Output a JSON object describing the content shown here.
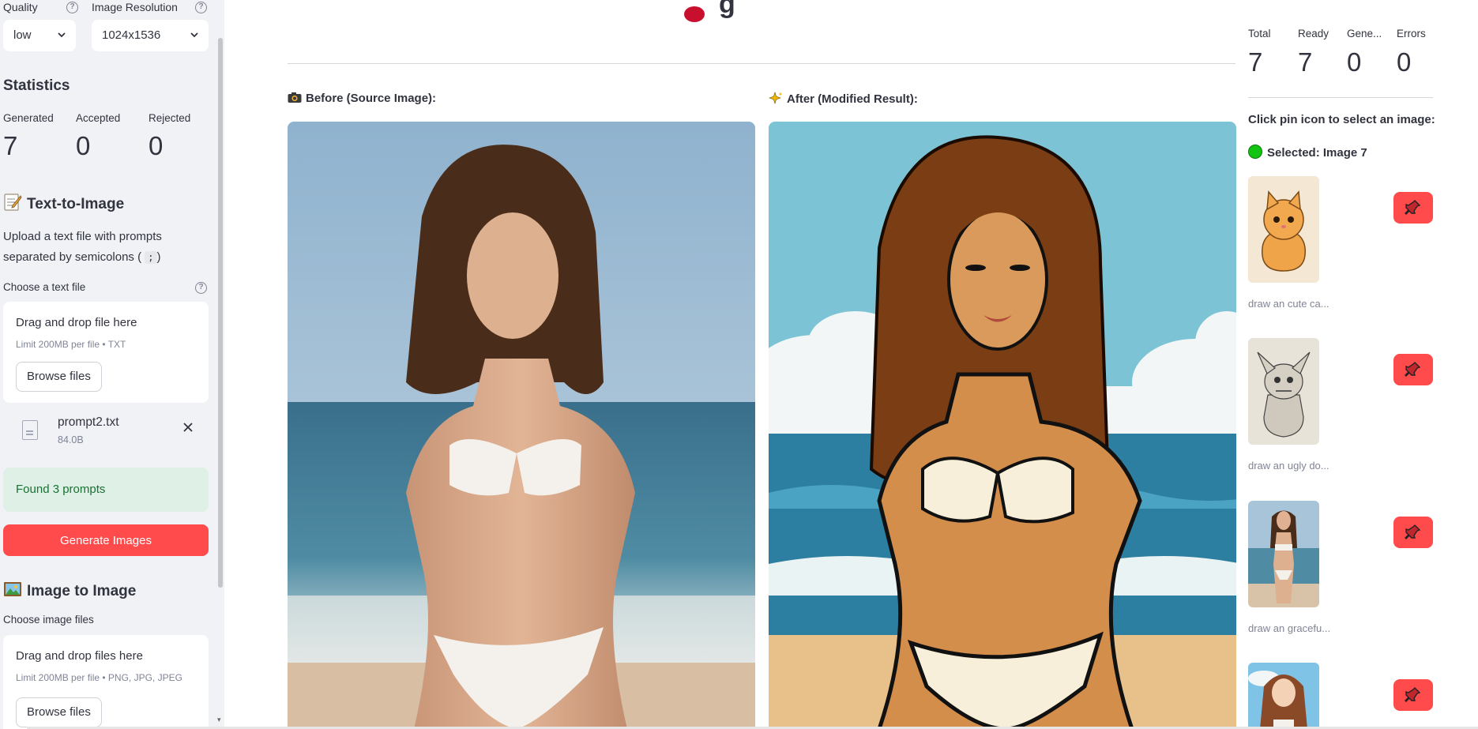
{
  "sidebar": {
    "quality_label": "Quality",
    "quality_value": "low",
    "resolution_label": "Image Resolution",
    "resolution_value": "1024x1536",
    "help_icon": "?",
    "statistics_title": "Statistics",
    "metrics": [
      {
        "label": "Generated",
        "value": "7"
      },
      {
        "label": "Accepted",
        "value": "0"
      },
      {
        "label": "Rejected",
        "value": "0"
      }
    ],
    "text_to_image": {
      "title": "Text-to-Image",
      "description_pre": "Upload a text file with prompts separated by semicolons (",
      "description_code": ";",
      "description_post": ")",
      "file_label": "Choose a text file",
      "drop_title": "Drag and drop file here",
      "drop_limit": "Limit 200MB per file • TXT",
      "browse_label": "Browse files",
      "file_name": "prompt2.txt",
      "file_size": "84.0B",
      "success_message": "Found 3 prompts",
      "generate_label": "Generate Images"
    },
    "image_to_image": {
      "title": "Image to Image",
      "file_label": "Choose image files",
      "drop_title": "Drag and drop files here",
      "drop_limit": "Limit 200MB per file • PNG, JPG, JPEG",
      "browse_label": "Browse files"
    }
  },
  "main": {
    "before_caption": "Before (Source Image):",
    "after_caption": "After (Modified Result):"
  },
  "right_panel": {
    "stats": [
      {
        "label": "Total",
        "value": "7"
      },
      {
        "label": "Ready",
        "value": "7"
      },
      {
        "label": "Gene...",
        "value": "0"
      },
      {
        "label": "Errors",
        "value": "0"
      }
    ],
    "select_prompt": "Click pin icon to select an image:",
    "selected_text": "Selected: Image 7",
    "thumbnails": [
      {
        "caption": "draw an cute ca..."
      },
      {
        "caption": "draw an ugly do..."
      },
      {
        "caption": "draw an gracefu..."
      },
      {
        "caption": ""
      }
    ]
  },
  "colors": {
    "primary": "#ff4b4b",
    "sidebar_bg": "#f0f2f6",
    "success_bg": "#dff0e6",
    "success_text": "#177233",
    "selected_dot": "#12c312"
  },
  "icons": {
    "select_chevron": "chevron-down-icon",
    "help": "help-circle-icon",
    "file": "file-icon",
    "remove": "close-icon",
    "pin": "pin-icon",
    "text_to_image": "memo-icon",
    "image_to_image": "framed-picture-icon",
    "before": "camera-icon",
    "after": "sparkles-icon",
    "selected": "green-circle-icon"
  }
}
